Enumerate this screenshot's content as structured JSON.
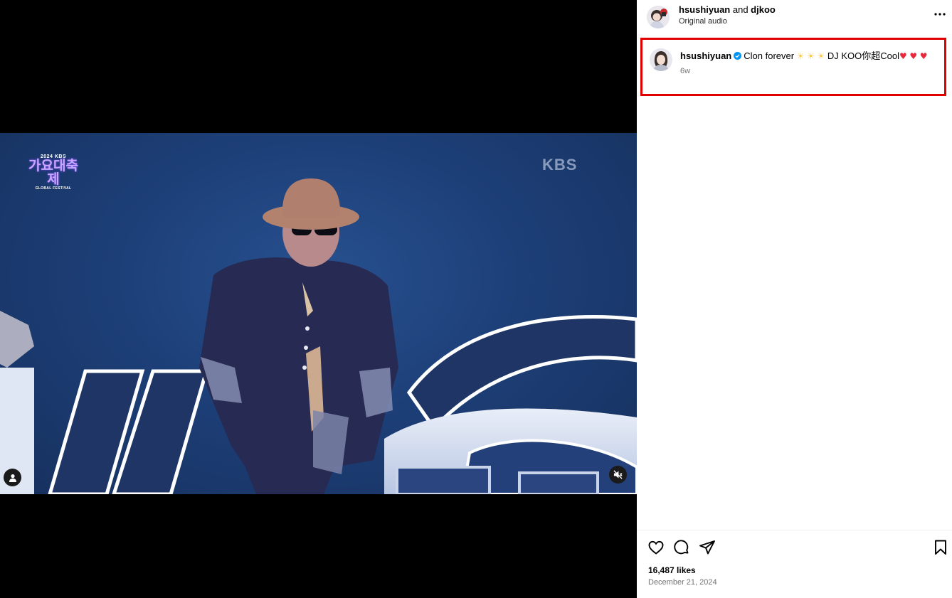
{
  "video": {
    "festival_logo": {
      "year": "2024 KBS",
      "name": "가요대축제",
      "sub": "GLOBAL FESTIVAL"
    },
    "watermark": "KBS",
    "icons": {
      "tag": "person-tag-icon",
      "mute": "muted-speaker-icon"
    }
  },
  "header": {
    "user1": "hsushiyuan",
    "connector": " and ",
    "user2": "djkoo",
    "audio": "Original audio",
    "more_icon": "more-horizontal-icon"
  },
  "caption": {
    "username": "hsushiyuan",
    "text_part1": "Clon forever ",
    "sun_emoji": "☀",
    "text_part2": "DJ KOO你超Cool",
    "heart_emoji": "♥",
    "time": "6w",
    "highlight_color": "#e00000"
  },
  "actions": {
    "icons": [
      "heart-icon",
      "comment-icon",
      "share-icon",
      "bookmark-icon"
    ]
  },
  "likes": "16,487 likes",
  "date": "December 21, 2024"
}
